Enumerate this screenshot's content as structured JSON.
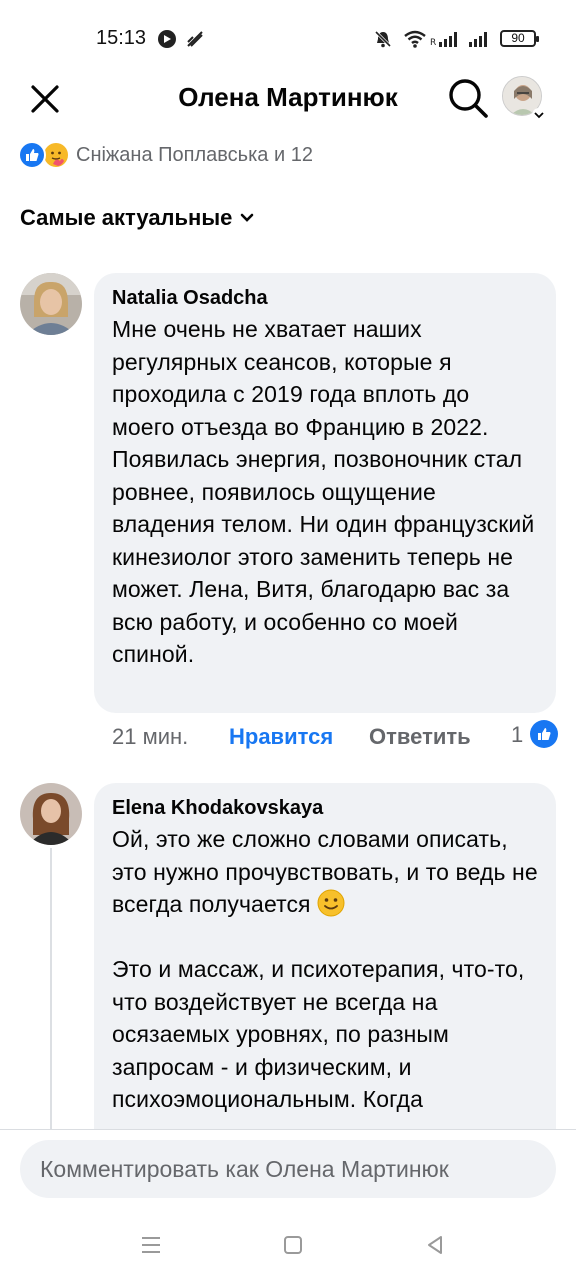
{
  "status_bar": {
    "time": "15:13",
    "battery": "90"
  },
  "header": {
    "title": "Олена Мартинюк"
  },
  "reactions": {
    "summary": "Сніжана Поплавська и 12"
  },
  "sort": {
    "label": "Самые актуальные"
  },
  "comments": [
    {
      "author": "Natalia Osadcha",
      "text": "Мне очень не хватает наших регулярных сеансов, которые я проходила с 2019 года вплоть до моего отъезда во Францию в 2022. Появилась энергия, позвоночник стал ровнее, появилось ощущение владения телом. Ни один французский кинезиолог этого заменить теперь не может. Лена, Витя, благодарю вас за всю работу, и особенно со моей спиной.",
      "time": "21 мин.",
      "like_label": "Нравится",
      "reply_label": "Ответить",
      "reaction_count": "1"
    },
    {
      "author": "Elena Khodakovskaya",
      "text_part1": "Ой, это же сложно словами описать, это нужно прочувствовать, и то ведь не всегда получается",
      "text_part2": "Это и массаж, и психотерапия, что-то, что воздействует не всегда на осязаемых уровнях, по разным запросам - и физическим, и психоэмоциональным. Когда"
    }
  ],
  "comment_input": {
    "placeholder": "Комментировать как Олена Мартинюк"
  },
  "colors": {
    "accent": "#1877f2",
    "bubble": "#f0f2f5",
    "secondary_text": "#65676b"
  }
}
